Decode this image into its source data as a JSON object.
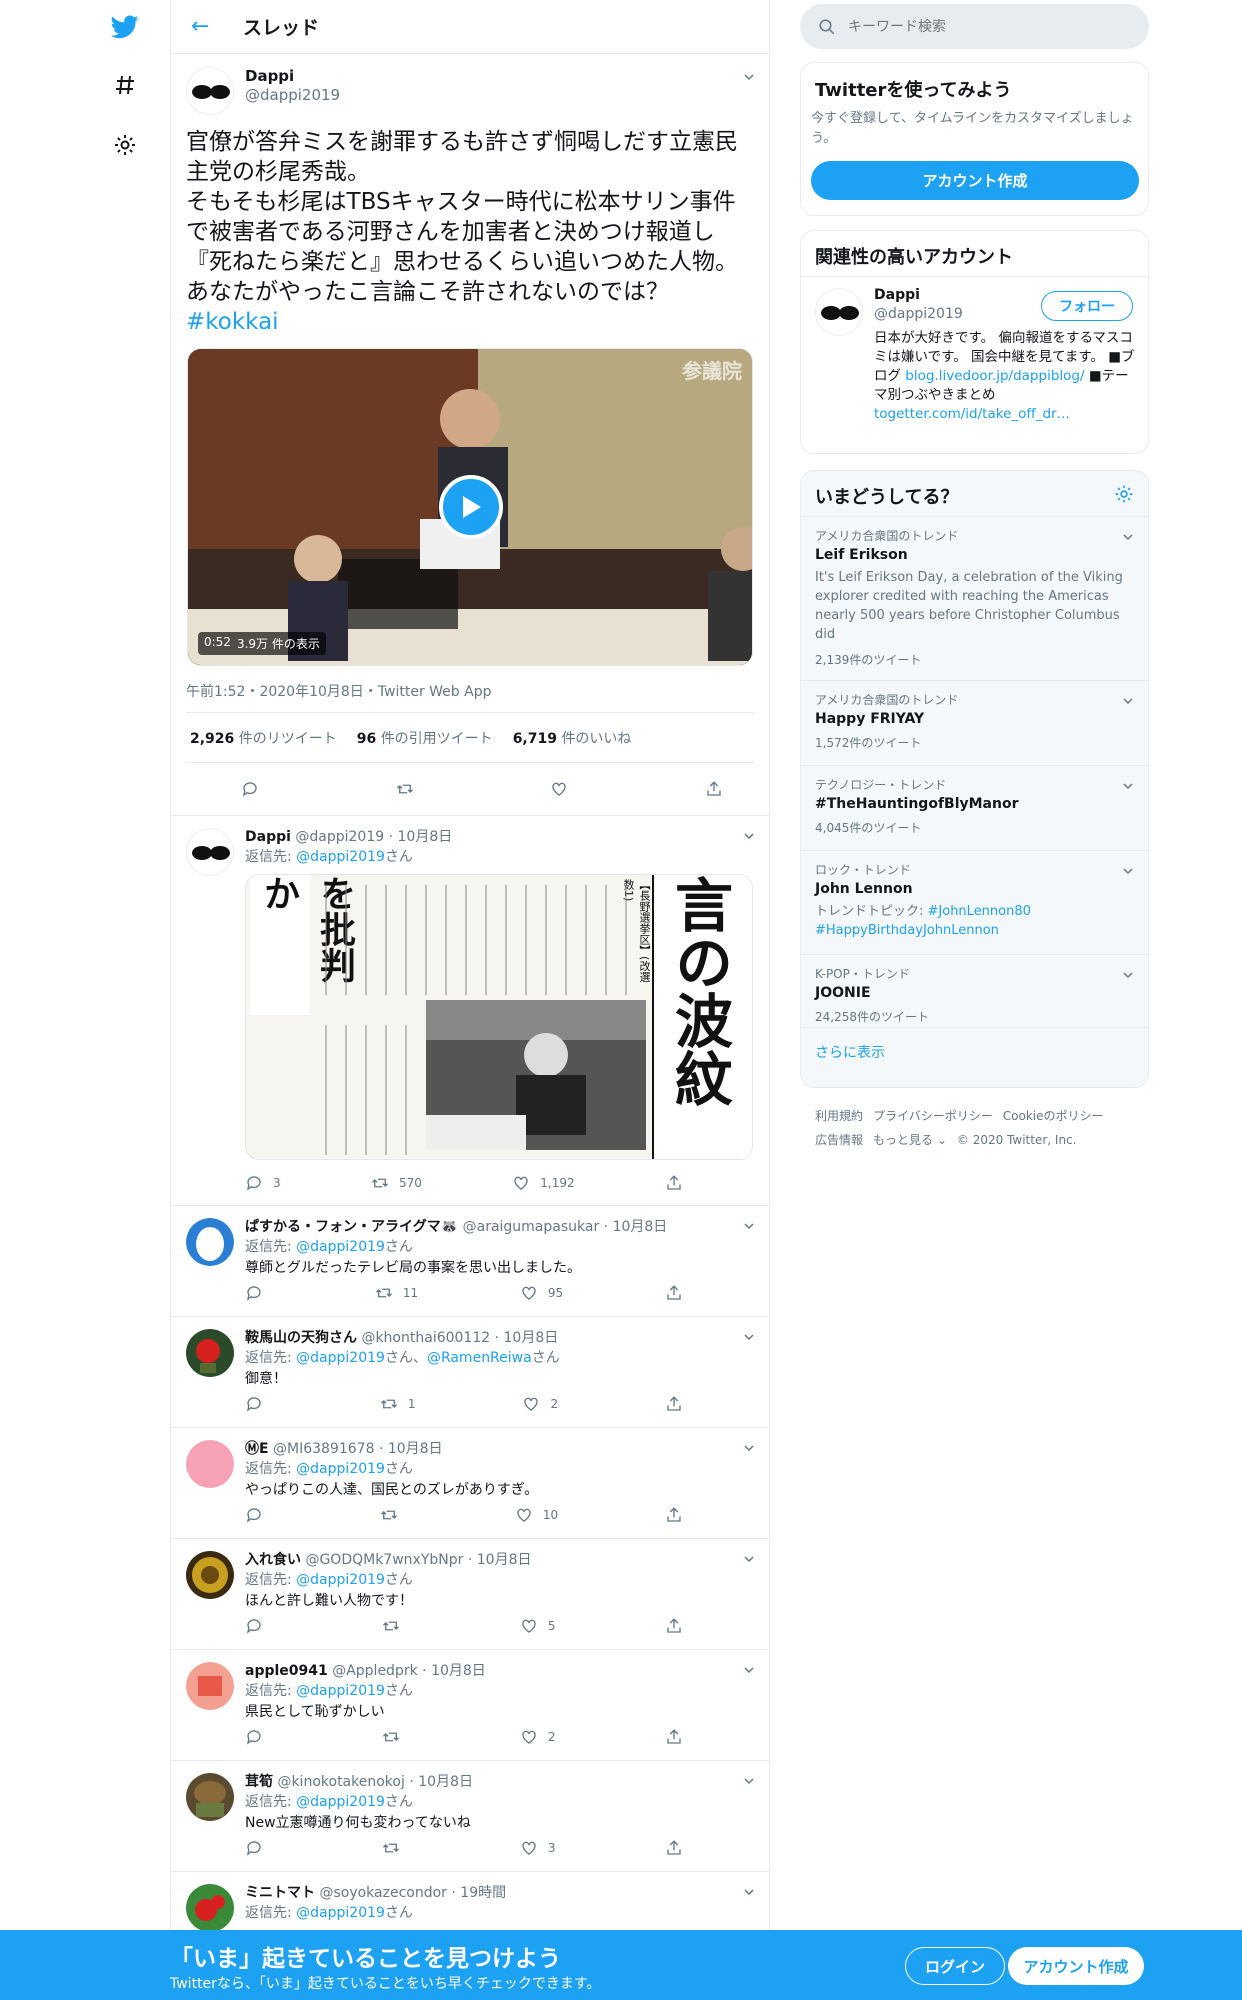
{
  "nav": {
    "logo": "twitter-bird-icon",
    "explore": "hashtag-icon",
    "settings": "gear-icon"
  },
  "thread": {
    "title": "スレッド"
  },
  "main_tweet": {
    "name": "Dappi",
    "handle": "@dappi2019",
    "text": "官僚が答弁ミスを謝罪するも許さず恫喝しだす立憲民主党の杉尾秀哉。\nそもそも杉尾はTBSキャスター時代に松本サリン事件で被害者である河野さんを加害者と決めつけ報道し『死ねたら楽だと』思わせるくらい追いつめた人物。あなたがやったこ言論こそ許されないのでは？",
    "hashtag": "#kokkai",
    "video": {
      "duration": "0:52",
      "views": "3.9万 件の表示",
      "watermark": "参議院"
    },
    "datetime": "午前1:52・2020年10月8日・Twitter Web App",
    "retweets": "2,926",
    "retweets_label": "件のリツイート",
    "quotes": "96",
    "quotes_label": "件の引用ツイート",
    "likes": "6,719",
    "likes_label": "件のいいね"
  },
  "replies": [
    {
      "name": "Dappi",
      "handle": "@dappi2019",
      "time": "10月8日",
      "to_prefix": "返信先: ",
      "to": "@dappi2019",
      "to2": "",
      "to_suffix": "さん",
      "body": "",
      "reply_count": "3",
      "rt_count": "570",
      "like_count": "1,192",
      "image_text": {
        "headline": "言の波紋",
        "sub": "を批判か",
        "small": "【長野選挙区】(改選数1)"
      }
    },
    {
      "name": "ぱすかる・フォン・アライグマ🦝",
      "handle": "@araigumapasukar",
      "time": "10月8日",
      "to_prefix": "返信先: ",
      "to": "@dappi2019",
      "to_suffix": "さん",
      "body": "尊師とグルだったテレビ局の事案を思い出しました。",
      "reply_count": "",
      "rt_count": "11",
      "like_count": "95"
    },
    {
      "name": "鞍馬山の天狗さん",
      "handle": "@khonthai600112",
      "time": "10月8日",
      "to_prefix": "返信先: ",
      "to": "@dappi2019",
      "to_mid": "さん、",
      "to2": "@RamenReiwa",
      "to_suffix": "さん",
      "body": "御意！",
      "reply_count": "",
      "rt_count": "1",
      "like_count": "2"
    },
    {
      "name": "ⓂE",
      "handle": "@MI63891678",
      "time": "10月8日",
      "to_prefix": "返信先: ",
      "to": "@dappi2019",
      "to_suffix": "さん",
      "body": "やっぱりこの人達、国民とのズレがありすぎ。",
      "reply_count": "",
      "rt_count": "",
      "like_count": "10"
    },
    {
      "name": "入れ食い",
      "handle": "@GODQMk7wnxYbNpr",
      "time": "10月8日",
      "to_prefix": "返信先: ",
      "to": "@dappi2019",
      "to_suffix": "さん",
      "body": "ほんと許し難い人物です！",
      "reply_count": "",
      "rt_count": "",
      "like_count": "5"
    },
    {
      "name": "apple0941",
      "handle": "@Appledprk",
      "time": "10月8日",
      "to_prefix": "返信先: ",
      "to": "@dappi2019",
      "to_suffix": "さん",
      "body": "県民として恥ずかしい",
      "reply_count": "",
      "rt_count": "",
      "like_count": "2"
    },
    {
      "name": "茸筍",
      "handle": "@kinokotakenokoj",
      "time": "10月8日",
      "to_prefix": "返信先: ",
      "to": "@dappi2019",
      "to_suffix": "さん",
      "body": "New立憲噂通り何も変わってないね",
      "reply_count": "",
      "rt_count": "",
      "like_count": "3"
    },
    {
      "name": "ミニトマト",
      "handle": "@soyokazecondor",
      "time": "19時間",
      "to_prefix": "返信先: ",
      "to": "@dappi2019",
      "to_suffix": "さん",
      "body": "",
      "reply_count": "",
      "rt_count": "",
      "like_count": ""
    }
  ],
  "search": {
    "placeholder": "キーワード検索"
  },
  "signup_card": {
    "title": "Twitterを使ってみよう",
    "desc": "今すぐ登録して、タイムラインをカスタマイズしましょう。",
    "button": "アカウント作成"
  },
  "related": {
    "title": "関連性の高いアカウント",
    "name": "Dappi",
    "handle": "@dappi2019",
    "follow": "フォロー",
    "bio1": "日本が大好きです。 偏向報道をするマスコミは嫌いです。 国会中継を見てます。 ■ブログ",
    "link1": "blog.livedoor.jp/dappiblog/",
    "bio2": " ■テーマ別つぶやきまとめ",
    "link2": "togetter.com/id/take_off_dr…"
  },
  "trends": {
    "title": "いまどうしてる？",
    "items": [
      {
        "ctx": "アメリカ合衆国のトレンド",
        "name": "Leif Erikson",
        "desc": "It's Leif Erikson Day, a celebration of the Viking explorer credited with reaching the Americas nearly 500 years before Christopher Columbus did",
        "count": "2,139件のツイート"
      },
      {
        "ctx": "アメリカ合衆国のトレンド",
        "name": "Happy FRIYAY",
        "desc": "",
        "count": "1,572件のツイート"
      },
      {
        "ctx": "テクノロジー・トレンド",
        "name": "#TheHauntingofBlyManor",
        "desc": "",
        "count": "4,045件のツイート"
      },
      {
        "ctx": "ロック・トレンド",
        "name": "John Lennon",
        "desc_prefix": "トレンドトピック: ",
        "link1": "#JohnLennon80",
        "link2": "#HappyBirthdayJohnLennon",
        "count": ""
      },
      {
        "ctx": "K-POP・トレンド",
        "name": "JOONIE",
        "desc": "",
        "count": "24,258件のツイート"
      }
    ],
    "more": "さらに表示"
  },
  "footer": {
    "l1": "利用規約",
    "l2": "プライバシーポリシー",
    "l3": "Cookieのポリシー",
    "l4": "広告情報",
    "l5": "もっと見る ⌄",
    "l6": "© 2020 Twitter, Inc."
  },
  "banner": {
    "big": "「いま」起きていることを見つけよう",
    "small": "Twitterなら、「いま」起きていることをいち早くチェックできます。",
    "login": "ログイン",
    "signup": "アカウント作成"
  },
  "colors": {
    "accent": "#1da1f2",
    "secondary_text": "#657786",
    "border": "#e6ecf0"
  }
}
